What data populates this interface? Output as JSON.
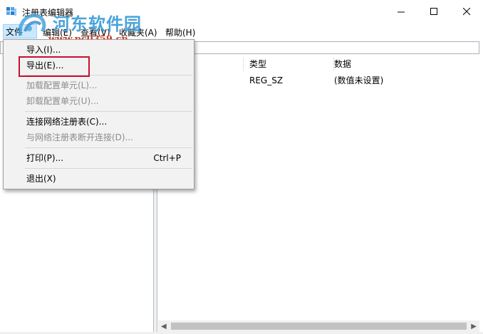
{
  "window": {
    "title": "注册表编辑器",
    "controls": {
      "minimize": "—",
      "maximize": "☐",
      "close": "✕"
    }
  },
  "watermark": {
    "name": "河东软件园",
    "url": "www.pc0359.cn"
  },
  "menubar": {
    "file": "文件(F)",
    "edit": "编辑(E)",
    "view": "查看(V)",
    "favorites": "收藏夹(A)",
    "help": "帮助(H)"
  },
  "addressbar": {
    "value": ""
  },
  "list": {
    "columns": {
      "name": "",
      "type": "类型",
      "data": "数据"
    },
    "rows": [
      {
        "name": ")",
        "type": "REG_SZ",
        "data": "(数值未设置)"
      }
    ]
  },
  "file_menu": {
    "items": [
      {
        "label": "导入(I)...",
        "shortcut": "",
        "enabled": true
      },
      {
        "label": "导出(E)...",
        "shortcut": "",
        "enabled": true
      },
      {
        "label": "加载配置单元(L)...",
        "shortcut": "",
        "enabled": false
      },
      {
        "label": "卸载配置单元(U)...",
        "shortcut": "",
        "enabled": false
      },
      {
        "label": "连接网络注册表(C)...",
        "shortcut": "",
        "enabled": true
      },
      {
        "label": "与网络注册表断开连接(D)...",
        "shortcut": "",
        "enabled": false
      },
      {
        "label": "打印(P)...",
        "shortcut": "Ctrl+P",
        "enabled": true
      },
      {
        "label": "退出(X)",
        "shortcut": "",
        "enabled": true
      }
    ]
  },
  "colors": {
    "highlight_border": "#c8102e",
    "menu_active": "#cce8ff",
    "watermark_blue": "#49a3da",
    "watermark_red": "#d23c2c"
  }
}
